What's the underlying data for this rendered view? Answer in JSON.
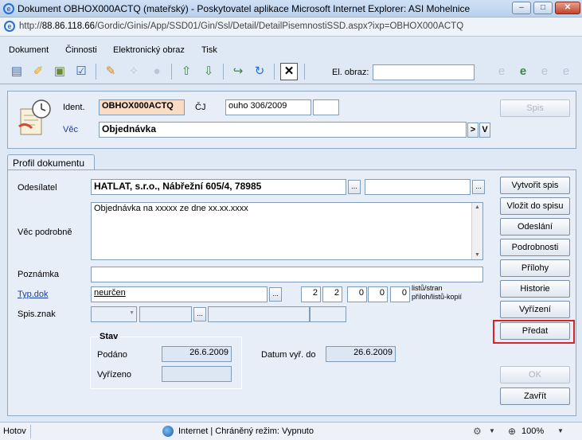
{
  "window": {
    "title": "Dokument OBHOX000ACTQ (mateřský) - Poskytovatel aplikace Microsoft Internet Explorer: ASI Mohelnice",
    "url_prefix": "http://",
    "url_host": "88.86.118.66",
    "url_path": "/Gordic/Ginis/App/SSD01/Gin/Ssl/Detail/DetailPisemnostiSSD.aspx?ixp=OBHOX000ACTQ"
  },
  "menu": [
    "Dokument",
    "Činnosti",
    "Elektronický obraz",
    "Tisk"
  ],
  "toolbar": {
    "el_obraz_label": "El. obraz:"
  },
  "header": {
    "ident_label": "Ident.",
    "ident_value": "OBHOX000ACTQ",
    "cj_label": "ČJ",
    "cj_value": "ouho 306/2009",
    "vec_label": "Věc",
    "vec_value": "Objednávka",
    "nav_btn": ">",
    "dropdown_btn": "V",
    "spis_btn": "Spis"
  },
  "tabs": [
    "Profil dokumentu"
  ],
  "profil": {
    "odesilatel_label": "Odesílatel",
    "odesilatel_value": "HATLAT, s.r.o.,  Nábřežní 605/4,  78985",
    "vec_podrobne_label": "Věc podrobně",
    "vec_podrobne_value": "Objednávka na xxxxx ze dne xx.xx.xxxx",
    "poznamka_label": "Poznámka",
    "typ_dok_label": "Typ.dok",
    "typ_dok_value": "neurčen",
    "counts": [
      "2",
      "2",
      "0",
      "0",
      "0"
    ],
    "counts_label_1": "listů/stran",
    "counts_label_2": "příloh/listů-kopií",
    "spis_znak_label": "Spis.znak",
    "ellipsis": "..."
  },
  "stav": {
    "title": "Stav",
    "podano_label": "Podáno",
    "podano_value": "26.6.2009",
    "vyrizeno_label": "Vyřízeno",
    "vyrizeno_value": "",
    "datum_vyr_label": "Datum vyř. do",
    "datum_vyr_value": "26.6.2009"
  },
  "actions": [
    "Vytvořit spis",
    "Vložit do spisu",
    "Odeslání",
    "Podrobnosti",
    "Přílohy",
    "Historie",
    "Vyřízení",
    "Předat"
  ],
  "footer_buttons": {
    "ok": "OK",
    "close": "Zavřít"
  },
  "highlight_color": "#d8232a",
  "status": {
    "left": "Hotov",
    "zone": "Internet | Chráněný režim: Vypnuto",
    "zoom": "100%"
  }
}
